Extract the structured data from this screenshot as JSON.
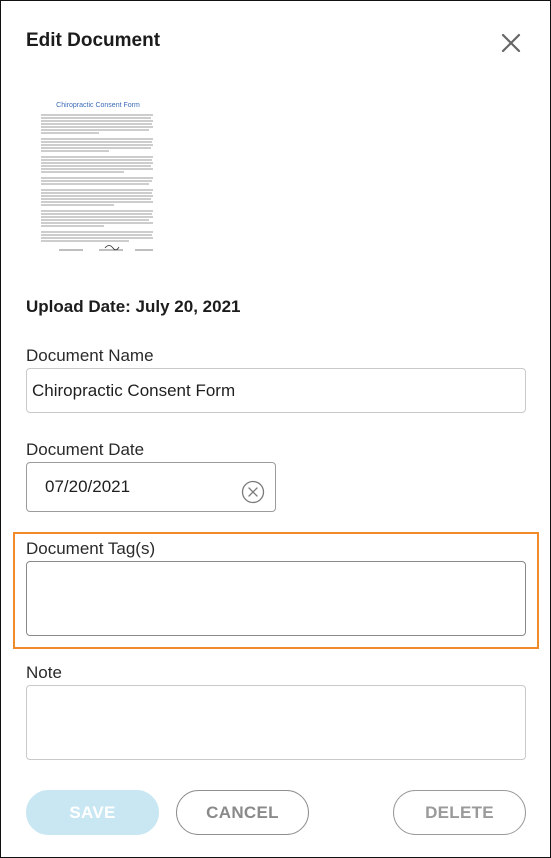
{
  "dialog": {
    "title": "Edit Document",
    "close_icon": "close-icon"
  },
  "preview": {
    "document_title": "Chiropractic Consent Form"
  },
  "upload_date": "Upload Date: July 20, 2021",
  "fields": {
    "document_name": {
      "label": "Document Name",
      "value": "Chiropractic Consent Form"
    },
    "document_date": {
      "label": "Document Date",
      "value": "07/20/2021",
      "clear_icon": "clear-circle-icon"
    },
    "document_tags": {
      "label": "Document Tag(s)",
      "value": ""
    },
    "note": {
      "label": "Note",
      "value": ""
    }
  },
  "buttons": {
    "save": "SAVE",
    "cancel": "CANCEL",
    "delete": "DELETE"
  },
  "colors": {
    "highlight": "#f08a2b",
    "save_disabled": "#c9e7f3"
  }
}
